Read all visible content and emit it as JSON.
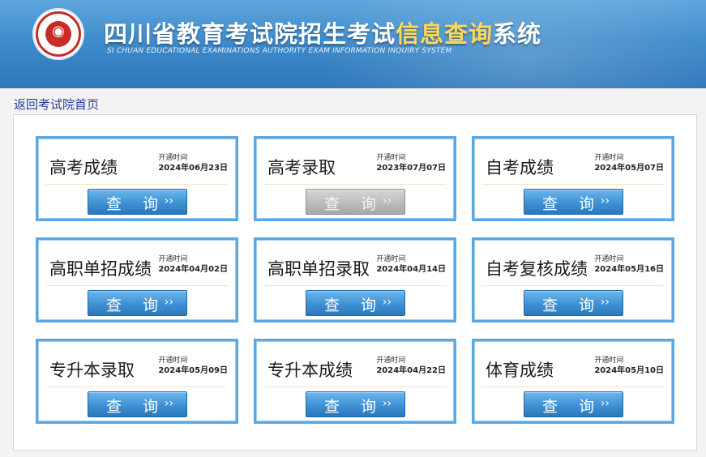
{
  "header": {
    "title_part1": "四川省教育考试院招生考试",
    "title_part2": "信息查询",
    "title_part3": "系统",
    "subtitle": "SI CHUAN EDUCATIONAL EXAMINATIONS AUTHORITY EXAM INFORMATION INQUIRY SYSTEM"
  },
  "nav": {
    "back_link": "返回考试院首页"
  },
  "cards": [
    {
      "name": "高考成绩",
      "meta_label": "开通时间",
      "date": "2024年06月23日",
      "button": "查 询",
      "arrow": "››",
      "enabled": true
    },
    {
      "name": "高考录取",
      "meta_label": "开通时间",
      "date": "2023年07月07日",
      "button": "查 询",
      "arrow": "››",
      "enabled": false
    },
    {
      "name": "自考成绩",
      "meta_label": "开通时间",
      "date": "2024年05月07日",
      "button": "查 询",
      "arrow": "››",
      "enabled": true
    },
    {
      "name": "高职单招成绩",
      "meta_label": "开通时间",
      "date": "2024年04月02日",
      "button": "查 询",
      "arrow": "››",
      "enabled": true
    },
    {
      "name": "高职单招录取",
      "meta_label": "开通时间",
      "date": "2024年04月14日",
      "button": "查 询",
      "arrow": "››",
      "enabled": true
    },
    {
      "name": "自考复核成绩",
      "meta_label": "开通时间",
      "date": "2024年05月16日",
      "button": "查 询",
      "arrow": "››",
      "enabled": true
    },
    {
      "name": "专升本录取",
      "meta_label": "开通时间",
      "date": "2024年05月09日",
      "button": "查 询",
      "arrow": "››",
      "enabled": true
    },
    {
      "name": "专升本成绩",
      "meta_label": "开通时间",
      "date": "2024年04月22日",
      "button": "查 询",
      "arrow": "››",
      "enabled": true
    },
    {
      "name": "体育成绩",
      "meta_label": "开通时间",
      "date": "2024年05月10日",
      "button": "查 询",
      "arrow": "››",
      "enabled": true
    }
  ]
}
